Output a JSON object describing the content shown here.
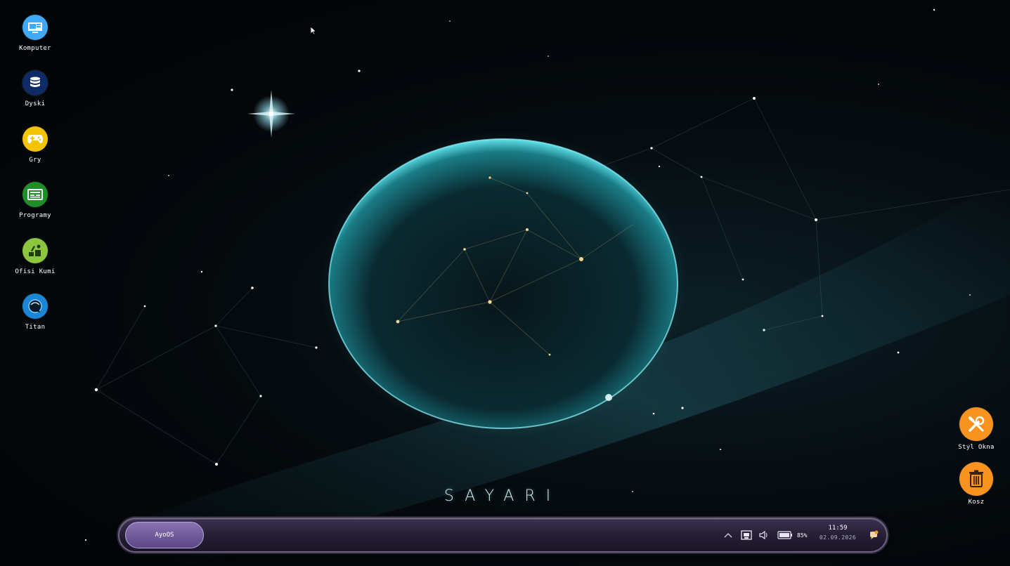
{
  "wallpaper": {
    "brand_text": "SAYARI",
    "accent_color": "#5fe1ea"
  },
  "desktop_icons_left": [
    {
      "label": "Komputer",
      "icon": "computer-icon",
      "color": "#3fa9f5"
    },
    {
      "label": "Dyski",
      "icon": "disks-icon",
      "color": "#0e2b66"
    },
    {
      "label": "Gry",
      "icon": "gamepad-icon",
      "color": "#f5c400"
    },
    {
      "label": "Programy",
      "icon": "programs-icon",
      "color": "#1e8e2a"
    },
    {
      "label": "Ofisi Kumi",
      "icon": "office-icon",
      "color": "#8cc63f"
    },
    {
      "label": "Titan",
      "icon": "titan-icon",
      "color": "#1b86d6"
    }
  ],
  "desktop_icons_right": [
    {
      "label": "Styl Okna",
      "icon": "tools-icon",
      "color": "#f7931e"
    },
    {
      "label": "Kosz",
      "icon": "trash-icon",
      "color": "#f7931e"
    }
  ],
  "taskbar": {
    "start_label": "AyoOS",
    "battery_percent": "85%",
    "time": "11:59",
    "date": "02.09.2026",
    "tray_icons": [
      "chevron-up-icon",
      "network-icon",
      "speaker-icon",
      "battery-icon",
      "notification-icon"
    ]
  }
}
